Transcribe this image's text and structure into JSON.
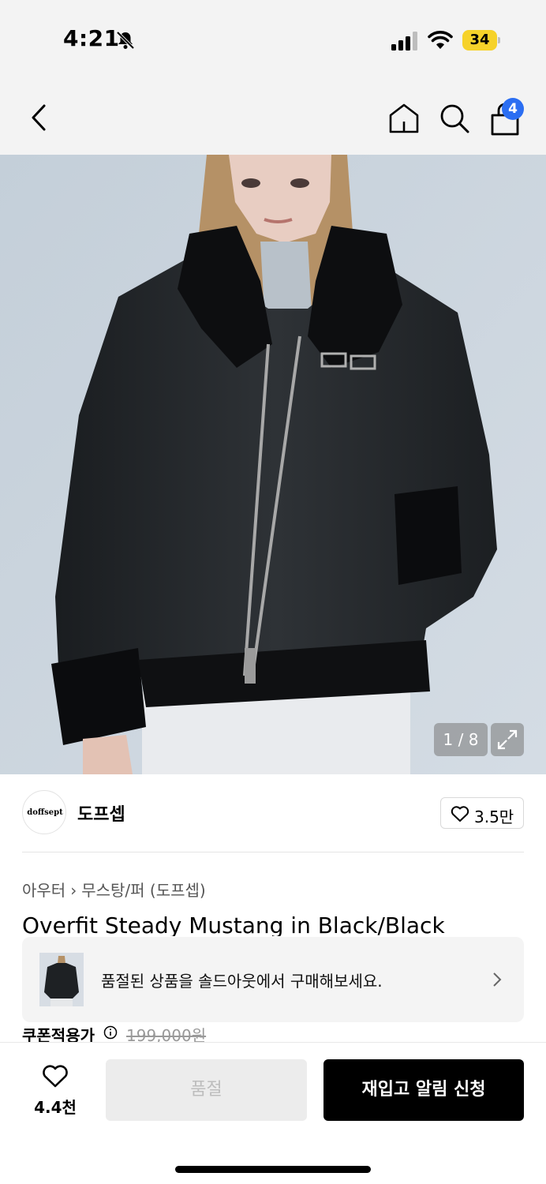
{
  "status_bar": {
    "time": "4:21",
    "battery": "34",
    "battery_color": "#f6d22a"
  },
  "header": {
    "cart_count": "4",
    "badge_color": "#2b6ef2",
    "icons": [
      "back-arrow-icon",
      "home-icon",
      "search-icon",
      "shopping-bag-icon"
    ]
  },
  "gallery": {
    "counter": "1 / 8"
  },
  "brand": {
    "logo_text": "doffsept",
    "name": "도프셉",
    "likes": "3.5만"
  },
  "breadcrumb": {
    "category": "아우터",
    "subcategory": "무스탕/퍼 (도프셉)"
  },
  "product": {
    "title": "Overfit Steady Mustang in Black/Black"
  },
  "soldout_banner": {
    "text": "품절된 상품을 솔드아웃에서 구매해보세요."
  },
  "price": {
    "label": "쿠폰적용가",
    "original": "199,000원"
  },
  "bottom_bar": {
    "wish_count": "4.4천",
    "soldout_label": "품절",
    "restock_label": "재입고 알림 신청",
    "primary_color": "#000000"
  }
}
